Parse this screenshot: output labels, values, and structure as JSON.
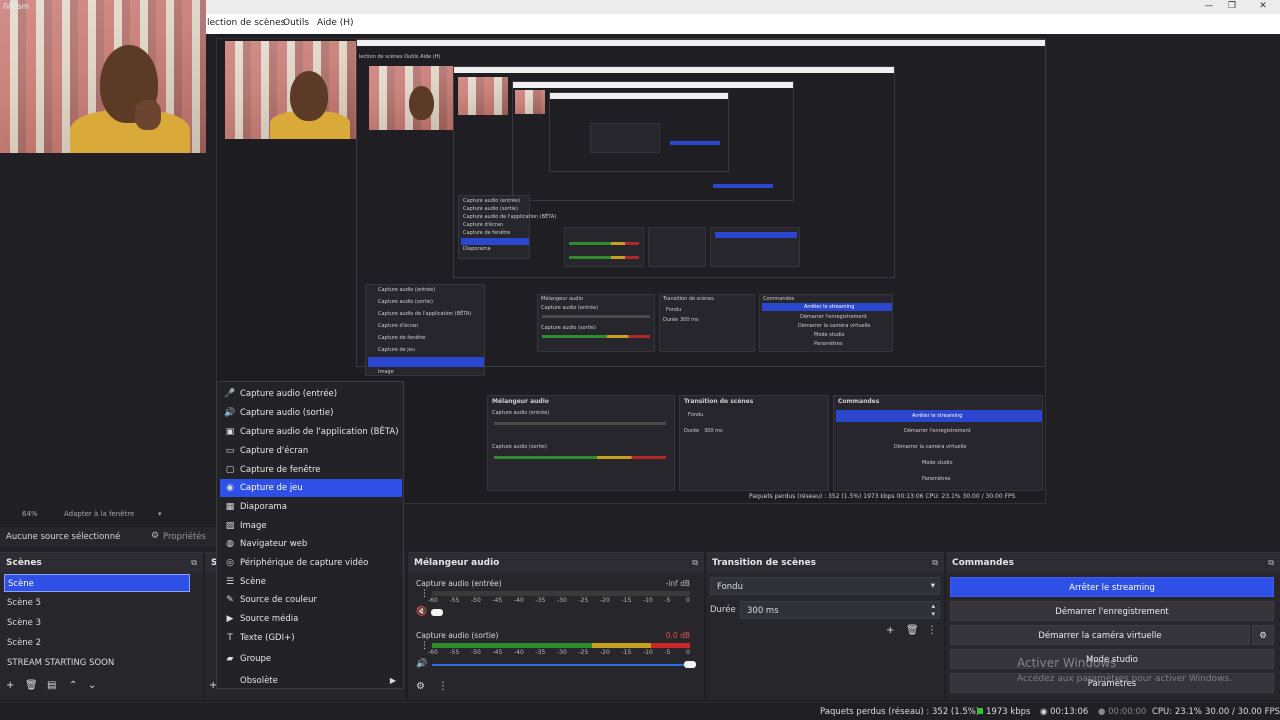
{
  "window": {
    "menu_items": [
      "lection de scènes",
      "Outils",
      "Aide (H)"
    ]
  },
  "webcam": {
    "label": "IVCam"
  },
  "preview": {
    "zoom": "64%",
    "scale_mode": "Adapter à la fenêtre",
    "nested_menu_items": [
      "Capture audio (entrée)",
      "Capture audio (sortie)",
      "Capture audio de l'application (BÊTA)",
      "Capture d'écran",
      "Capture de fenêtre",
      "Capture de jeu",
      "Diaporama",
      "Image"
    ],
    "nested_mixer_title": "Mélangeur audio",
    "nested_transition_title": "Transition de scènes",
    "nested_commands_title": "Commandes",
    "nested_stop_stream": "Arrêter le streaming",
    "nested_start_rec": "Démarrer l'enregistrement",
    "nested_virtual_cam": "Démarrer la caméra virtuelle",
    "nested_studio": "Mode studio",
    "nested_settings": "Paramètres",
    "nested_fade": "Fondu",
    "nested_duration_label": "Durée",
    "nested_duration": "300 ms",
    "nested_mic": "Capture audio (entrée)",
    "nested_desktop": "Capture audio (sortie)",
    "nested_status": "Paquets perdus (réseau) : 352 (1.5%)   1973 kbps   00:13:06   CPU: 23.1%   30.00 / 30.00 FPS"
  },
  "properties_bar": {
    "no_source": "Aucune source sélectionné",
    "properties_label": "Propriétés"
  },
  "scenes": {
    "title": "Scènes",
    "items": [
      "Scène",
      "Scène 5",
      "Scène 3",
      "Scène 2",
      "STREAM STARTING SOON"
    ]
  },
  "sources": {
    "title_partial": "S"
  },
  "context_menu": {
    "items": [
      {
        "label": "Capture audio (entrée)",
        "icon": "microphone-icon"
      },
      {
        "label": "Capture audio (sortie)",
        "icon": "speaker-icon"
      },
      {
        "label": "Capture audio de l'application (BÊTA)",
        "icon": "app-audio-icon"
      },
      {
        "label": "Capture d'écran",
        "icon": "monitor-icon"
      },
      {
        "label": "Capture de fenêtre",
        "icon": "window-icon"
      },
      {
        "label": "Capture de jeu",
        "icon": "gamepad-icon"
      },
      {
        "label": "Diaporama",
        "icon": "slideshow-icon"
      },
      {
        "label": "Image",
        "icon": "image-icon"
      },
      {
        "label": "Navigateur web",
        "icon": "globe-icon"
      },
      {
        "label": "Périphérique de capture vidéo",
        "icon": "camera-icon"
      },
      {
        "label": "Scène",
        "icon": "list-icon"
      },
      {
        "label": "Source de couleur",
        "icon": "brush-icon"
      },
      {
        "label": "Source média",
        "icon": "play-icon"
      },
      {
        "label": "Texte (GDI+)",
        "icon": "text-icon"
      },
      {
        "label": "Groupe",
        "icon": "folder-icon"
      },
      {
        "label": "Obsolète",
        "icon": ""
      }
    ],
    "selected_index": 5
  },
  "mixer": {
    "title": "Mélangeur audio",
    "channels": [
      {
        "name": "Capture audio (entrée)",
        "level": "-inf dB",
        "fill": 0.0,
        "volume": 0.02
      },
      {
        "name": "Capture audio (sortie)",
        "level": "0.0 dB",
        "fill": 1.0,
        "volume": 1.0
      }
    ],
    "ticks": [
      "-60",
      "-55",
      "-50",
      "-45",
      "-40",
      "-35",
      "-30",
      "-25",
      "-20",
      "-15",
      "-10",
      "-5",
      "0"
    ]
  },
  "transition": {
    "title": "Transition de scènes",
    "type": "Fondu",
    "duration_label": "Durée",
    "duration": "300 ms"
  },
  "commands": {
    "title": "Commandes",
    "stop_stream": "Arrêter le streaming",
    "start_rec": "Démarrer l'enregistrement",
    "virtual_cam": "Démarrer la caméra virtuelle",
    "studio_mode": "Mode studio",
    "settings": "Paramètres"
  },
  "watermark": {
    "line1": "Activer Windows",
    "line2": "Accédez aux paramètres pour activer Windows."
  },
  "status": {
    "dropped": "Paquets perdus (réseau) : 352 (1.5%)",
    "bitrate": "1973 kbps",
    "live_time": "00:13:06",
    "rec_time": "00:00:00",
    "cpu": "CPU: 23.1%",
    "fps": "30.00 / 30.00 FPS"
  },
  "colors": {
    "accent": "#2e50e6",
    "background": "#1f1f24",
    "panel": "#26262b"
  }
}
